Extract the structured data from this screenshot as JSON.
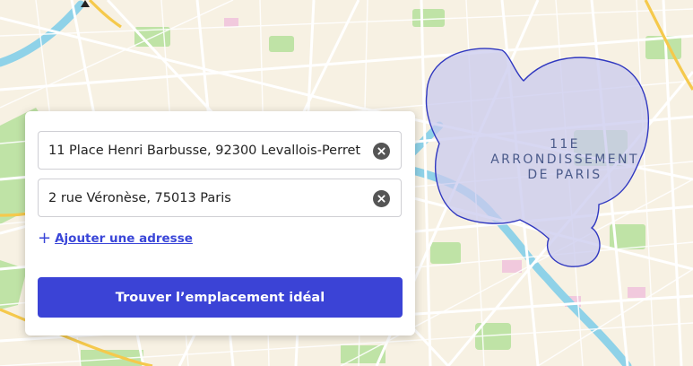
{
  "map": {
    "area_label_lines": [
      "11E",
      "ARRONDISSEMENT",
      "DE PARIS"
    ],
    "colors": {
      "base": "#f7f1e3",
      "park": "#bfe3a6",
      "water": "#8fd2e8",
      "road": "#ffffff",
      "highway": "#f5c94c",
      "zone_fill": "#c9c9ee",
      "zone_stroke": "#3038c0"
    }
  },
  "form": {
    "addresses": [
      {
        "value": "11 Place Henri Barbusse, 92300 Levallois-Perret"
      },
      {
        "value": "2 rue Véronèse, 75013 Paris"
      }
    ],
    "add_address_icon": "+",
    "add_address_label": "Ajouter une adresse",
    "submit_label": "Trouver l’emplacement idéal"
  }
}
